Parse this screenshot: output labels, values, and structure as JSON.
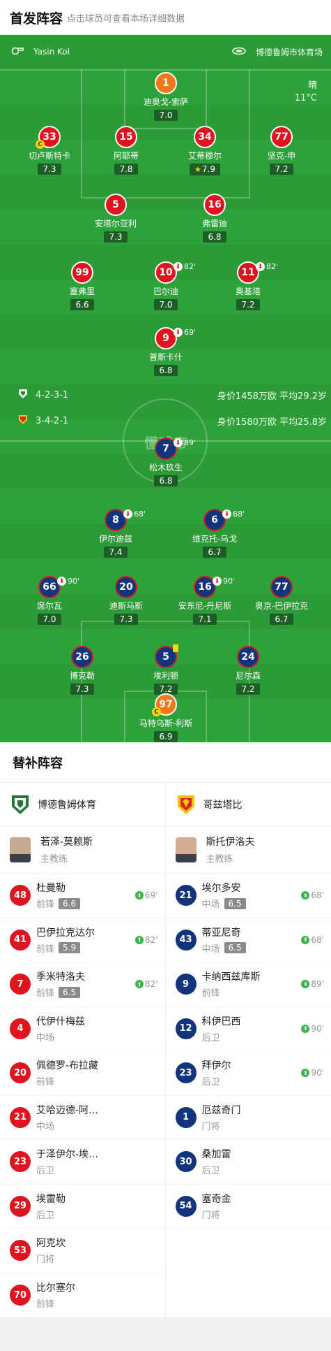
{
  "header": {
    "title": "首发阵容",
    "subtitle": "点击球员可查看本场详细数据"
  },
  "pitch": {
    "referee": "Yasin Kol",
    "venue": "博德鲁姆市体育场",
    "weather": "晴",
    "temperature": "11°C",
    "watermark": "懂球帝",
    "home_formation": "4-2-3-1",
    "home_value": "身价1458万欧 平均29.2岁",
    "away_formation": "3-4-2-1",
    "away_value": "身价1580万欧 平均25.8岁"
  },
  "home_players": [
    {
      "num": "1",
      "name": "迪奥戈-索萨",
      "rating": "7.0"
    },
    {
      "num": "33",
      "name": "切卢斯特卡",
      "rating": "7.3",
      "cap": "C"
    },
    {
      "num": "15",
      "name": "阿耶蒂",
      "rating": "7.8"
    },
    {
      "num": "34",
      "name": "艾蒂穆尔",
      "rating": "7.9"
    },
    {
      "num": "77",
      "name": "坚克-申",
      "rating": "7.2"
    },
    {
      "num": "5",
      "name": "安塔尔亚利",
      "rating": "7.3"
    },
    {
      "num": "16",
      "name": "弗雷迪",
      "rating": "6.8"
    },
    {
      "num": "99",
      "name": "塞弗里",
      "rating": "6.6"
    },
    {
      "num": "10",
      "name": "巴尔迪",
      "rating": "7.0",
      "off": "82'"
    },
    {
      "num": "11",
      "name": "奥基塔",
      "rating": "7.2",
      "off": "82'"
    },
    {
      "num": "9",
      "name": "普斯卡什",
      "rating": "6.8",
      "off": "69'"
    }
  ],
  "away_players": [
    {
      "num": "7",
      "name": "松木玖生",
      "rating": "6.8",
      "off": "89'"
    },
    {
      "num": "8",
      "name": "伊尔迪兹",
      "rating": "7.4",
      "off": "68'"
    },
    {
      "num": "6",
      "name": "维克托-乌戈",
      "rating": "6.7",
      "off": "68'"
    },
    {
      "num": "66",
      "name": "席尔瓦",
      "rating": "7.0",
      "off": "90'"
    },
    {
      "num": "20",
      "name": "迪斯马斯",
      "rating": "7.3"
    },
    {
      "num": "16",
      "name": "安东尼-丹尼斯",
      "rating": "7.1",
      "off": "90'"
    },
    {
      "num": "77",
      "name": "奥京-巴伊拉克",
      "rating": "6.7"
    },
    {
      "num": "26",
      "name": "博克勒",
      "rating": "7.3"
    },
    {
      "num": "5",
      "name": "埃利顿",
      "rating": "7.2"
    },
    {
      "num": "24",
      "name": "尼尔森",
      "rating": "7.2"
    },
    {
      "num": "97",
      "name": "马特乌斯-利斯",
      "rating": "6.9",
      "cap": "C"
    }
  ],
  "subs": {
    "title": "替补阵容",
    "home_team": "博德鲁姆体育",
    "away_team": "哥兹塔比",
    "home_coach": {
      "name": "若泽-莫赖斯",
      "role": "主教练"
    },
    "away_coach": {
      "name": "斯托伊洛夫",
      "role": "主教练"
    },
    "home": [
      {
        "num": "48",
        "name": "杜曼勒",
        "pos": "前锋",
        "rating": "6.6",
        "in": "69'"
      },
      {
        "num": "41",
        "name": "巴伊拉克达尔",
        "pos": "前锋",
        "rating": "5.9",
        "in": "82'"
      },
      {
        "num": "7",
        "name": "季米特洛夫",
        "pos": "前锋",
        "rating": "6.5",
        "in": "82'"
      },
      {
        "num": "4",
        "name": "代伊什梅兹",
        "pos": "中场"
      },
      {
        "num": "20",
        "name": "佩德罗-布拉藏",
        "pos": "前锋"
      },
      {
        "num": "21",
        "name": "艾哈迈德-阿…",
        "pos": "中场"
      },
      {
        "num": "23",
        "name": "于泽伊尔-埃…",
        "pos": "后卫"
      },
      {
        "num": "29",
        "name": "埃雷勒",
        "pos": "后卫"
      },
      {
        "num": "53",
        "name": "阿克坎",
        "pos": "门将"
      },
      {
        "num": "70",
        "name": "比尔塞尔",
        "pos": "前锋"
      }
    ],
    "away": [
      {
        "num": "21",
        "name": "埃尔多安",
        "pos": "中场",
        "rating": "6.5",
        "in": "68'"
      },
      {
        "num": "43",
        "name": "蒂亚尼奇",
        "pos": "中场",
        "rating": "6.5",
        "in": "68'"
      },
      {
        "num": "9",
        "name": "卡纳西兹库斯",
        "pos": "前锋",
        "in": "89'"
      },
      {
        "num": "12",
        "name": "科伊巴西",
        "pos": "后卫",
        "in": "90'"
      },
      {
        "num": "23",
        "name": "拜伊尔",
        "pos": "后卫",
        "in": "90'"
      },
      {
        "num": "1",
        "name": "厄兹奇门",
        "pos": "门将"
      },
      {
        "num": "30",
        "name": "桑加雷",
        "pos": "后卫"
      },
      {
        "num": "54",
        "name": "塞奇金",
        "pos": "门将"
      }
    ]
  },
  "colors": {
    "home": "#e0141e",
    "away": "#12347d",
    "pitch": "#2ea23a",
    "rating_bg": "#1d5e26"
  }
}
